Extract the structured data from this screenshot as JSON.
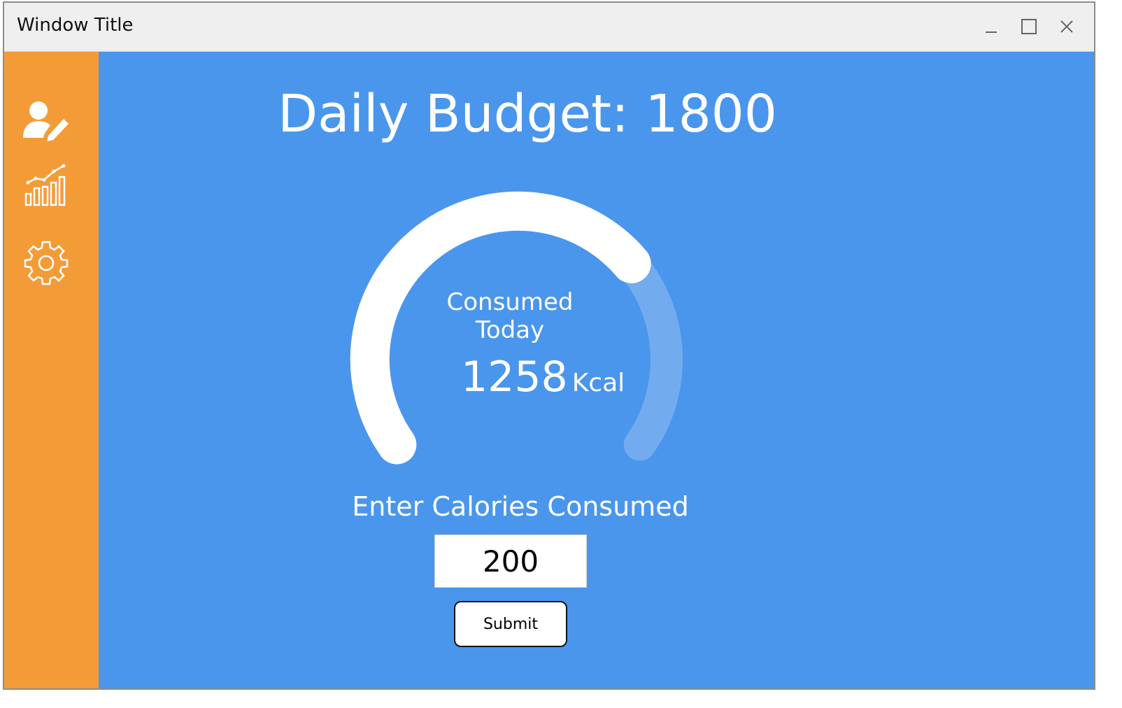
{
  "window": {
    "title": "Window Title",
    "controls": {
      "minimize_icon": "minimize-icon",
      "maximize_icon": "maximize-icon",
      "close_icon": "close-icon"
    }
  },
  "sidebar": {
    "items": [
      {
        "icon": "user-edit-icon"
      },
      {
        "icon": "chart-growth-icon"
      },
      {
        "icon": "gear-icon"
      }
    ]
  },
  "main": {
    "title": "Daily Budget: 1800",
    "gauge": {
      "label_line1": "Consumed",
      "label_line2": "Today",
      "value": "1258",
      "unit": "Kcal",
      "budget": 1800,
      "consumed": 1258
    },
    "form": {
      "label": "Enter Calories Consumed",
      "input_value": "200",
      "submit_label": "Submit"
    }
  },
  "colors": {
    "sidebar": "#f39c37",
    "main_background": "#4a96ec",
    "gauge_track": "#73abef",
    "gauge_fill": "#ffffff"
  }
}
